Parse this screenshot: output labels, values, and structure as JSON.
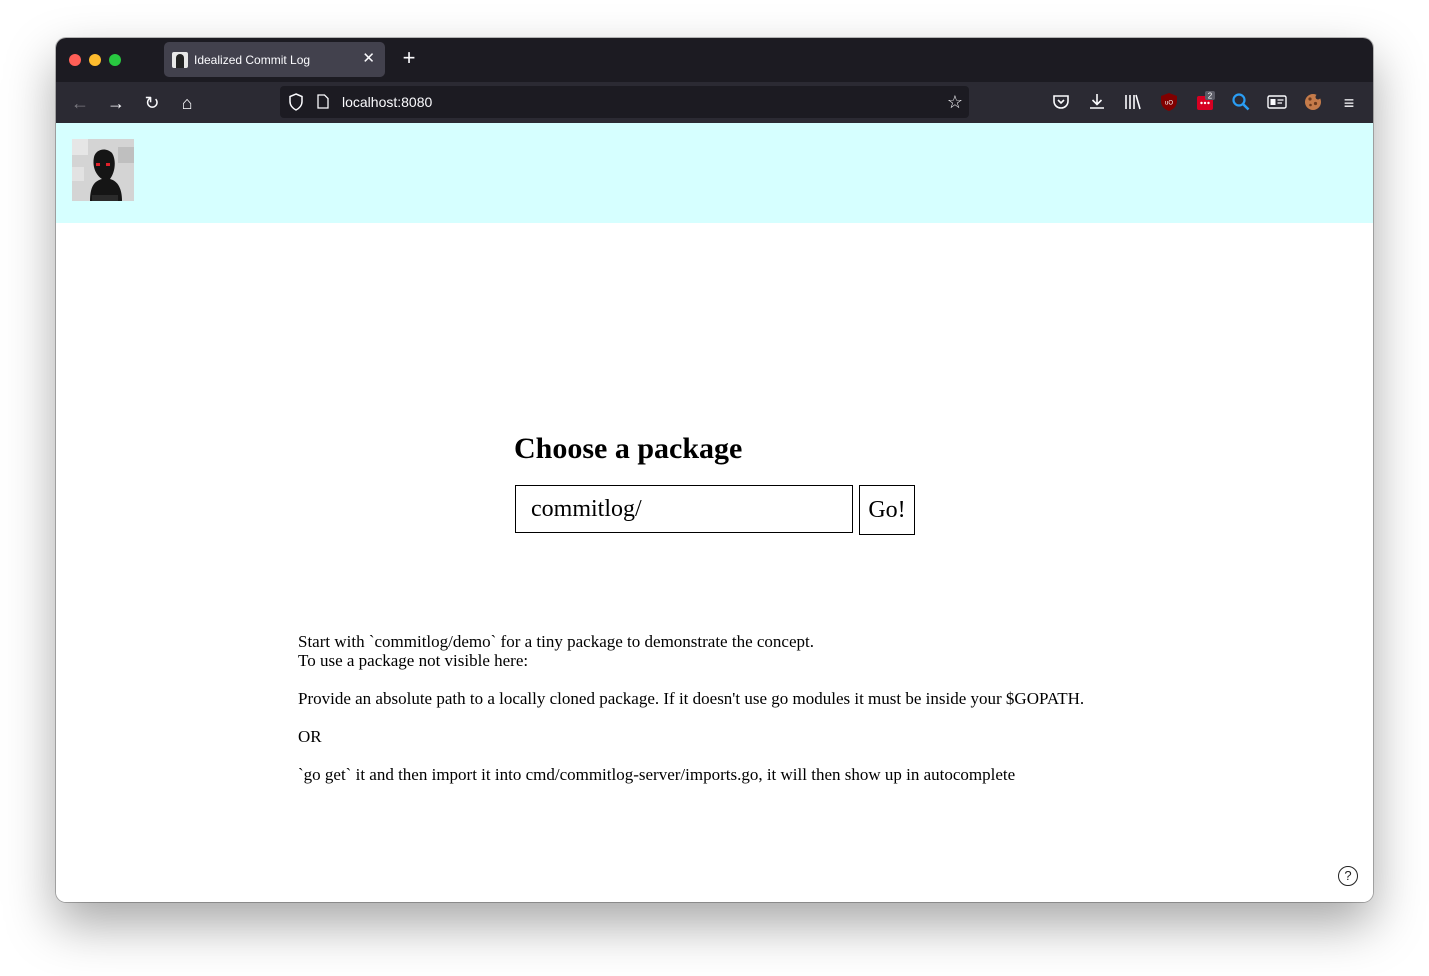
{
  "browser": {
    "tab": {
      "title": "Idealized Commit Log",
      "close_glyph": "✕"
    },
    "new_tab_glyph": "+",
    "url": "localhost:8080",
    "nav": {
      "back_glyph": "←",
      "forward_glyph": "→",
      "reload_glyph": "↻",
      "home_glyph": "⌂",
      "bookmark_glyph": "☆"
    },
    "toolbar_icons": [
      "pocket-icon",
      "download-icon",
      "library-icon",
      "ublock-icon",
      "extension-badge-icon",
      "search-extension-icon",
      "extension-card-icon",
      "cookie-icon",
      "menu-icon"
    ],
    "extension_badge_count": "2",
    "menu_glyph": "≡"
  },
  "header": {
    "background": "#d6ffff",
    "avatar_icon": "avatar-logo"
  },
  "chooser": {
    "title": "Choose a package",
    "input_value": "commitlog/",
    "go_label": "Go!"
  },
  "help": {
    "line1": "Start with `commitlog/demo` for a tiny package to demonstrate the concept.",
    "line2": "To use a package not visible here:",
    "line3": "Provide an absolute path to a locally cloned package. If it doesn't use go modules it must be inside your $GOPATH.",
    "line4": "OR",
    "line5": "`go get` it and then import it into cmd/commitlog-server/imports.go, it will then show up in autocomplete"
  },
  "help_button_glyph": "?"
}
